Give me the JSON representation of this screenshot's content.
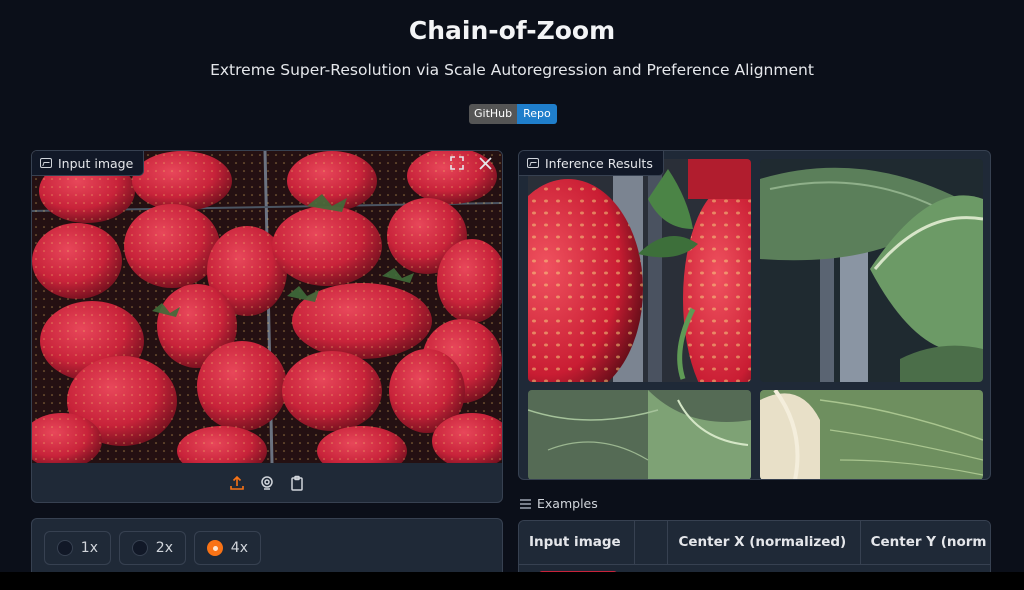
{
  "header": {
    "title": "Chain-of-Zoom",
    "subtitle": "Extreme Super-Resolution via Scale Autoregression and Preference Alignment",
    "badge_left": "GitHub",
    "badge_right": "Repo"
  },
  "input_panel": {
    "label": "Input image",
    "icons": [
      "image-icon",
      "fullscreen-icon",
      "close-icon",
      "upload-icon",
      "webcam-icon",
      "clipboard-icon"
    ]
  },
  "results_panel": {
    "label": "Inference Results"
  },
  "scale_options": [
    {
      "label": "1x",
      "selected": false
    },
    {
      "label": "2x",
      "selected": false
    },
    {
      "label": "4x",
      "selected": true
    }
  ],
  "examples": {
    "label": "Examples",
    "columns": [
      "Input image",
      "",
      "Center X (normalized)",
      "Center Y (norm"
    ]
  },
  "colors": {
    "background": "#0b0f19",
    "accent": "#f97316",
    "badge_blue": "#1f7ecb"
  }
}
